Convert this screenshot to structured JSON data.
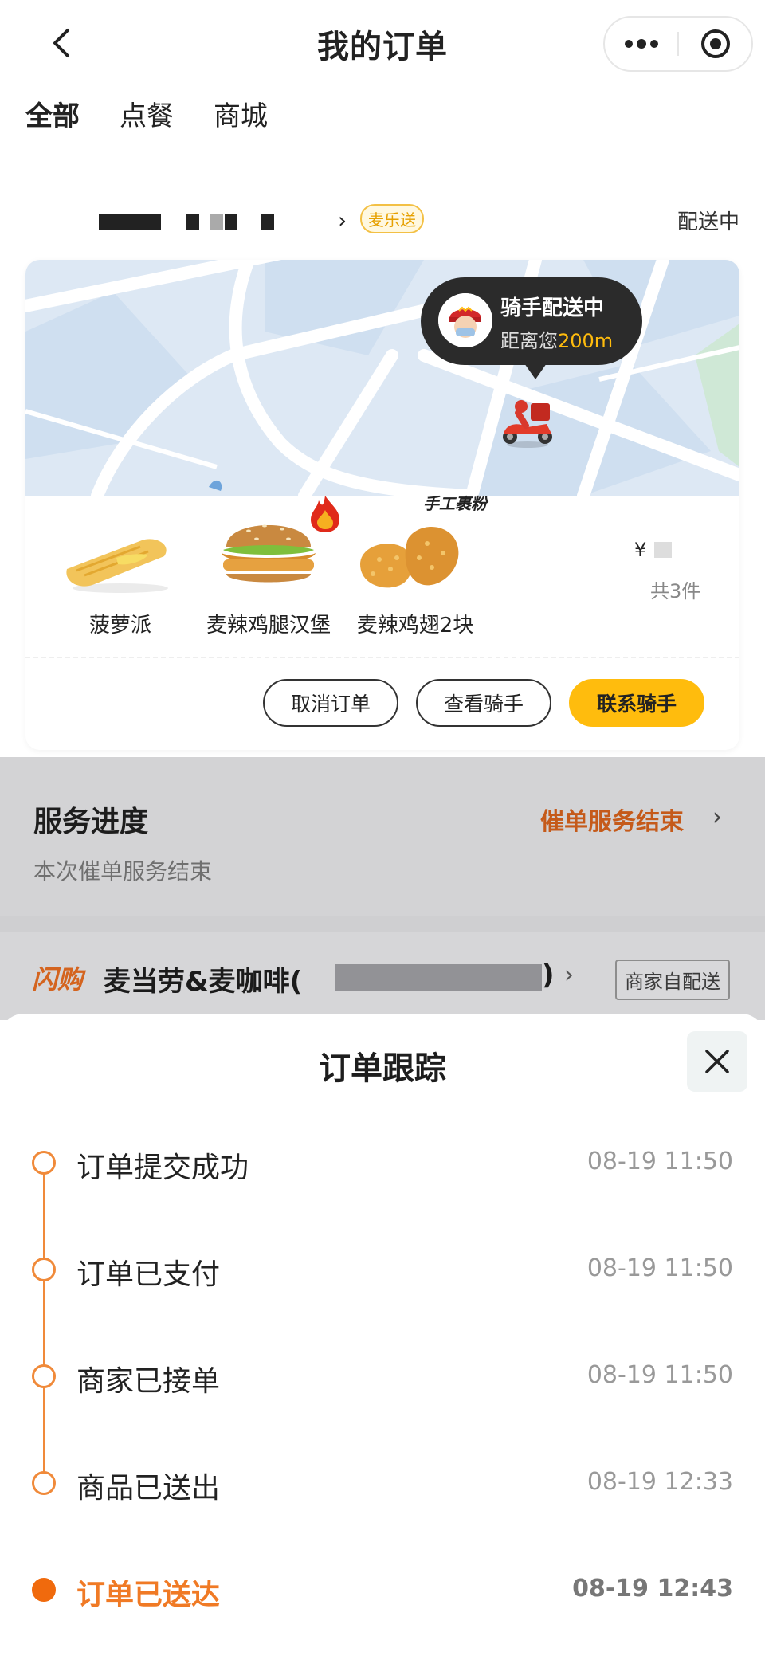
{
  "header": {
    "title": "我的订单",
    "back_icon": "chevron-left-icon",
    "more_icon": "more-dots-icon",
    "target_icon": "target-icon"
  },
  "tabs": [
    {
      "label": "全部",
      "active": true
    },
    {
      "label": "点餐",
      "active": false
    },
    {
      "label": "商城",
      "active": false
    }
  ],
  "order": {
    "tag": "麦乐送",
    "status": "配送中",
    "map": {
      "bubble_title": "骑手配送中",
      "bubble_prefix": "距离您",
      "bubble_distance": "200m"
    },
    "items": [
      {
        "name": "菠萝派"
      },
      {
        "name": "麦辣鸡腿汉堡"
      },
      {
        "name": "麦辣鸡翅2块",
        "badge": "手工裹粉"
      }
    ],
    "price_symbol": "¥",
    "count": "共3件",
    "actions": {
      "cancel": "取消订单",
      "view_rider": "查看骑手",
      "contact_rider": "联系骑手"
    }
  },
  "service": {
    "title": "服务进度",
    "status": "催单服务结束",
    "subtitle": "本次催单服务结束"
  },
  "store": {
    "flash_tag": "闪购",
    "name": "麦当劳&麦咖啡(",
    "name_suffix": ")",
    "delivery_tag": "商家自配送"
  },
  "tracking": {
    "title": "订单跟踪",
    "steps": [
      {
        "label": "订单提交成功",
        "time": "08-19 11:50"
      },
      {
        "label": "订单已支付",
        "time": "08-19 11:50"
      },
      {
        "label": "商家已接单",
        "time": "08-19 11:50"
      },
      {
        "label": "商品已送出",
        "time": "08-19 12:33"
      },
      {
        "label": "订单已送达",
        "time": "08-19 12:43",
        "current": true
      }
    ]
  },
  "colors": {
    "brand_yellow": "#ffbc0d",
    "timeline_orange": "#f08a3a",
    "flash_orange": "#d4641f"
  }
}
